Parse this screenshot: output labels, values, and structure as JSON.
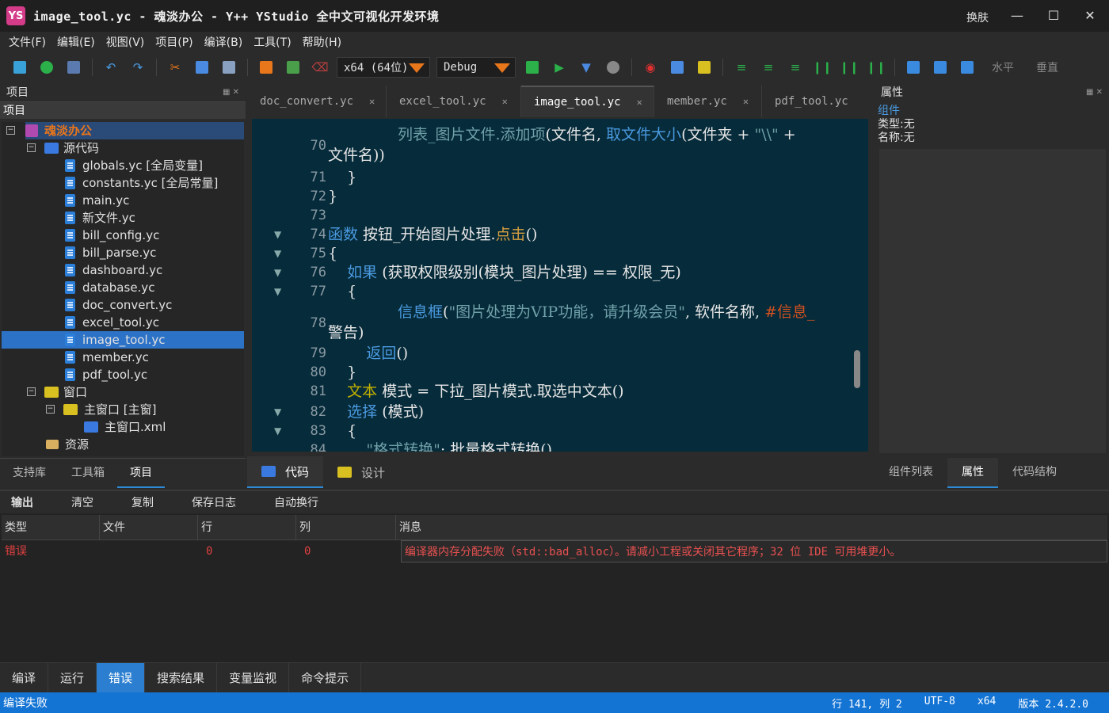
{
  "window": {
    "logo": "YS",
    "title": "image_tool.yc - 魂淡办公 - Y++ YStudio 全中文可视化开发环境",
    "skin_label": "换肤"
  },
  "menubar": [
    "文件(F)",
    "编辑(E)",
    "视图(V)",
    "项目(P)",
    "编译(B)",
    "工具(T)",
    "帮助(H)"
  ],
  "toolbar": {
    "platform": "x64 (64位)",
    "config": "Debug",
    "horizontal_label": "水平",
    "vertical_label": "垂直",
    "accent": "#e8761b"
  },
  "left_panel": {
    "header": "项目",
    "subheader": "项目",
    "tree": {
      "root": "魂淡办公",
      "source_folder": "源代码",
      "files": [
        "globals.yc [全局变量]",
        "constants.yc [全局常量]",
        "main.yc",
        "新文件.yc",
        "bill_config.yc",
        "bill_parse.yc",
        "dashboard.yc",
        "database.yc",
        "doc_convert.yc",
        "excel_tool.yc",
        "image_tool.yc",
        "member.yc",
        "pdf_tool.yc"
      ],
      "window_folder": "窗口",
      "main_window": "主窗口 [主窗]",
      "main_window_xml": "主窗口.xml",
      "resources": "资源"
    },
    "tabs": [
      "支持库",
      "工具箱",
      "项目"
    ]
  },
  "editor": {
    "tabs": [
      "doc_convert.yc",
      "excel_tool.yc",
      "image_tool.yc",
      "member.yc",
      "pdf_tool.yc"
    ],
    "active_tab": "image_tool.yc",
    "bottom_tabs": [
      "代码",
      "设计"
    ]
  },
  "right_panel": {
    "header": "属性",
    "component_label": "组件",
    "type_line": "类型:无",
    "name_line": "名称:无",
    "tabs": [
      "组件列表",
      "属性",
      "代码结构"
    ]
  },
  "output": {
    "title": "输出",
    "actions": [
      "清空",
      "复制",
      "保存日志",
      "自动换行"
    ],
    "columns": [
      "类型",
      "文件",
      "行",
      "列",
      "消息"
    ],
    "rows": [
      {
        "type": "错误",
        "file": "",
        "line": "0",
        "col": "0",
        "message": "编译器内存分配失败（std::bad_alloc）。请减小工程或关闭其它程序；32 位 IDE 可用堆更小。"
      }
    ],
    "bottom_tabs": [
      "编译",
      "运行",
      "错误",
      "搜索结果",
      "变量监视",
      "命令提示"
    ],
    "active_bottom_tab": "错误"
  },
  "statusbar": {
    "left": "编译失败",
    "position": "行 141, 列 2",
    "encoding": "UTF-8",
    "arch": "x64",
    "version": "版本 2.4.2.0"
  }
}
